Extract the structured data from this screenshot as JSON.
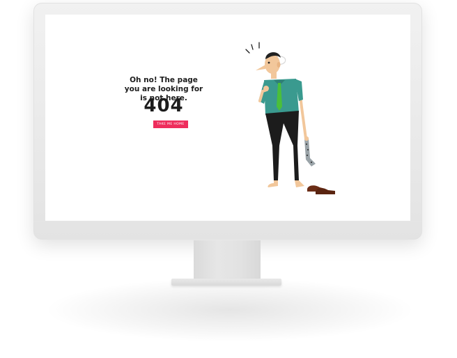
{
  "error_page": {
    "message": "Oh no! The page you are looking for is not here.",
    "code": "404",
    "home_button_label": "TAKE ME HOME"
  },
  "illustration": {
    "name": "confused-man-holding-sock",
    "colors": {
      "shirt": "#3a9a8f",
      "tie": "#4bbf3a",
      "trousers": "#1c1c1c",
      "skin": "#f2c79b",
      "hair": "#222222",
      "shoes": "#6b2d16",
      "sock": "#9aa3a8"
    }
  },
  "theme": {
    "accent": "#ee2d5c",
    "text": "#1c1c1c",
    "screen_background": "#ffffff",
    "bezel": "#ececec"
  }
}
